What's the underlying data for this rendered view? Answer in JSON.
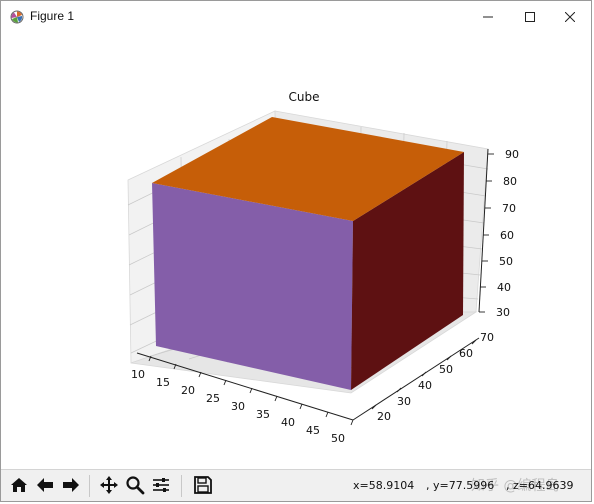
{
  "window": {
    "title": "Figure 1",
    "controls": {
      "minimize": "minimize",
      "maximize": "maximize",
      "close": "close"
    }
  },
  "icons": {
    "app": "matplotlib-logo-icon",
    "home": "home-icon",
    "back": "arrow-left-icon",
    "forward": "arrow-right-icon",
    "pan": "move-arrows-icon",
    "zoom": "magnifier-icon",
    "configure": "sliders-icon",
    "save": "floppy-disk-icon"
  },
  "colors": {
    "top_face": "#c65e08",
    "front_face": "#845ea9",
    "side_face": "#5e1112"
  },
  "chart_data": {
    "type": "surface-3d",
    "title": "Cube",
    "x_ticks": [
      "10",
      "15",
      "20",
      "25",
      "30",
      "35",
      "40",
      "45",
      "50"
    ],
    "y_ticks": [
      "20",
      "30",
      "40",
      "50",
      "60",
      "70"
    ],
    "z_ticks": [
      "30",
      "40",
      "50",
      "60",
      "70",
      "80",
      "90"
    ],
    "xlim": [
      10,
      50
    ],
    "ylim": [
      20,
      70
    ],
    "zlim": [
      30,
      90
    ],
    "grid": true,
    "faces": [
      {
        "name": "top",
        "color": "#c65e08"
      },
      {
        "name": "front",
        "color": "#845ea9"
      },
      {
        "name": "side",
        "color": "#5e1112"
      }
    ]
  },
  "status": {
    "x": "x=58.9104",
    "y": ", y=77.5996",
    "z": ", z=64.9639"
  },
  "watermark": "知乎 @编程岛"
}
